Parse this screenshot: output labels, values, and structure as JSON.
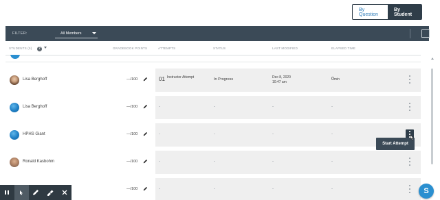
{
  "view_toggle": {
    "by_question": "By Question",
    "by_student": "By Student"
  },
  "filter": {
    "label": "FILTER:",
    "selected": "All Members"
  },
  "columns": {
    "students": "STUDENTS (5)",
    "gradebook_points": "GRADEBOOK POINTS",
    "attempts": "ATTEMPTS",
    "status": "STATUS",
    "last_modified": "LAST MODIFIED",
    "elapsed_time": "ELAPSED TIME"
  },
  "rows": [
    {
      "name": "Lisa Berghoff",
      "score": "—/100",
      "attempt_number": "01",
      "attempt_type": "Instructor Attempt",
      "status": "In Progress",
      "modified_date": "Dec 8, 2020",
      "modified_time": "10:47 am",
      "elapsed_value": "0",
      "elapsed_unit": "min"
    },
    {
      "name": "Lisa Berghoff",
      "score": "—/100",
      "attempts": "-",
      "status": "-",
      "modified": "-",
      "elapsed": "-"
    },
    {
      "name": "HPHS Giant",
      "score": "—/100",
      "attempts": "-",
      "status": "-",
      "modified": "-",
      "elapsed": "-"
    },
    {
      "name": "Ronald Kasbohm",
      "score": "—/100",
      "attempts": "-",
      "status": "-",
      "modified": "-",
      "elapsed": "-"
    },
    {
      "name": "",
      "score": "—/100",
      "attempts": "-",
      "status": "-",
      "modified": "-",
      "elapsed": "-"
    }
  ],
  "tooltip": {
    "label": "Start Attempt"
  },
  "fab": {
    "label": "S"
  },
  "colors": {
    "header_bar": "#3b4a57",
    "accent_blue": "#2a8fd0",
    "row_bg": "#efefef"
  },
  "icons": [
    "help-icon",
    "pencil-icon",
    "kebab-menu-icon",
    "pause-icon",
    "pointer-icon",
    "pen-icon",
    "highlighter-icon",
    "close-icon"
  ]
}
